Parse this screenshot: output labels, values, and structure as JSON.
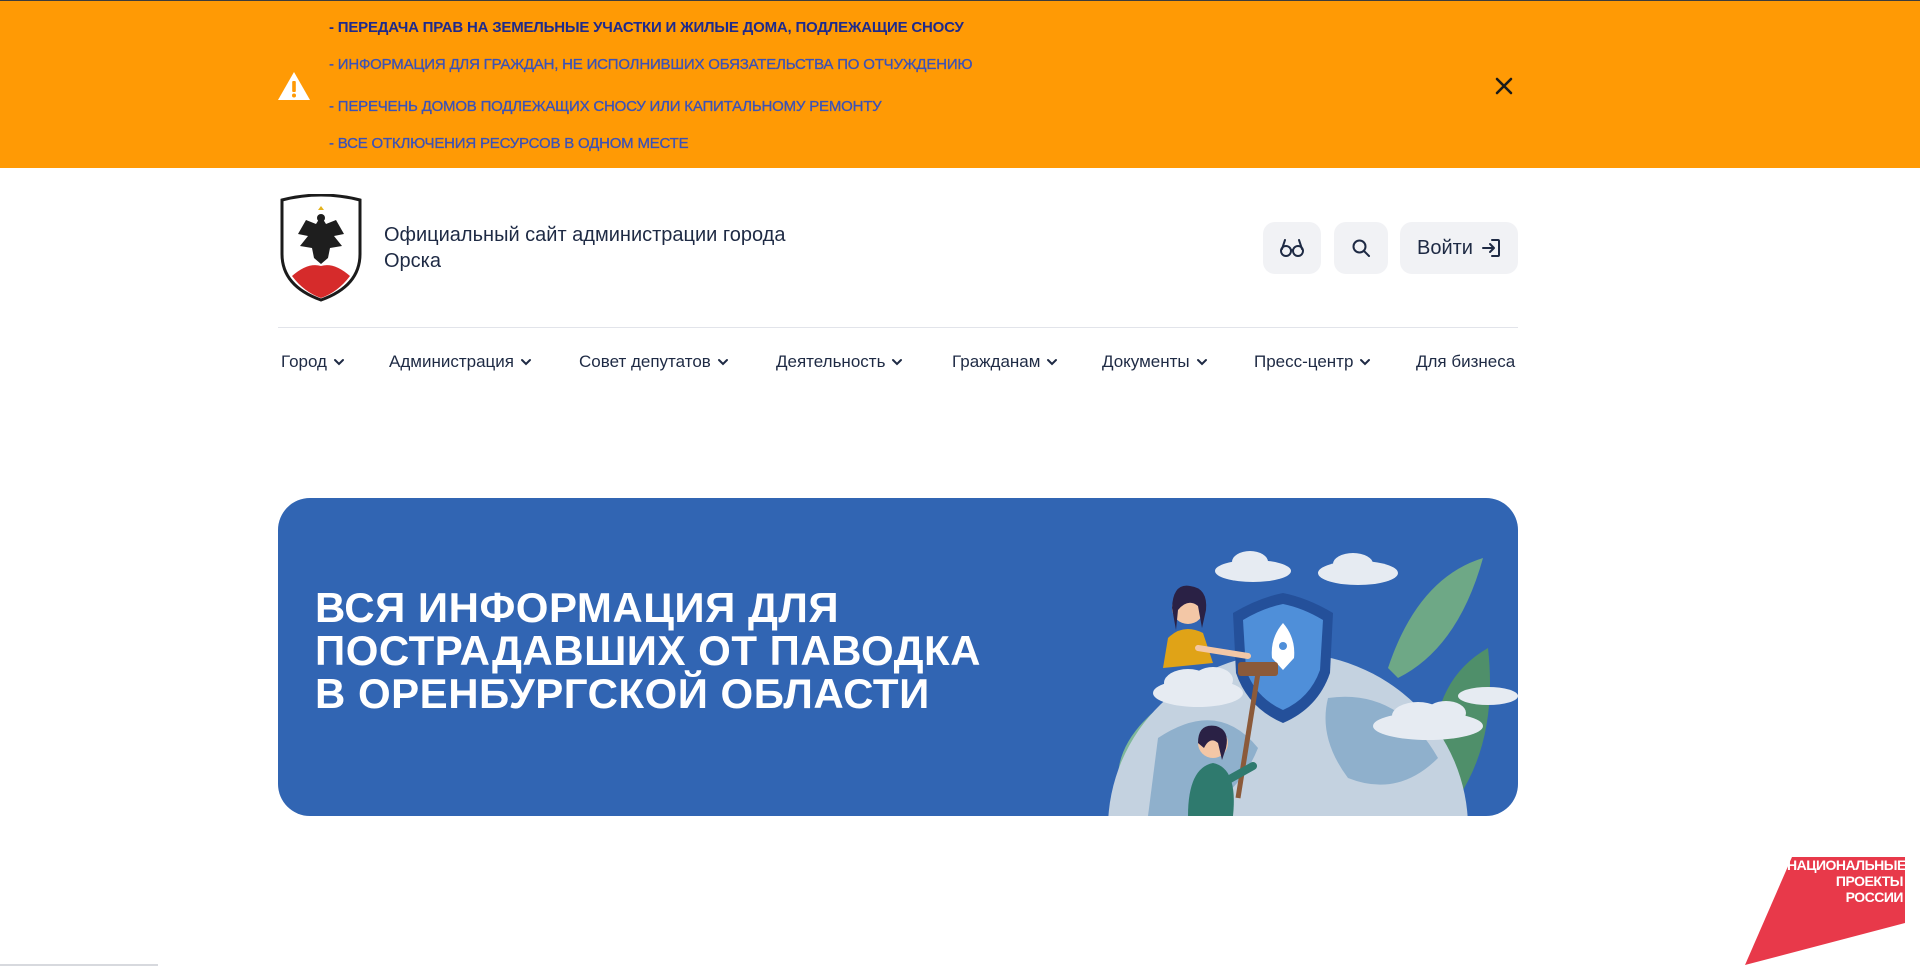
{
  "alert": {
    "links": [
      "- ПЕРЕДАЧА ПРАВ НА ЗЕМЕЛЬНЫЕ УЧАСТКИ И ЖИЛЫЕ ДОМА, ПОДЛЕЖАЩИЕ СНОСУ",
      "- ИНФОРМАЦИЯ ДЛЯ ГРАЖДАН, НЕ ИСПОЛНИВШИХ ОБЯЗАТЕЛЬСТВА ПО ОТЧУЖДЕНИЮ",
      "- ПЕРЕЧЕНЬ ДОМОВ ПОДЛЕЖАЩИХ СНОСУ ИЛИ КАПИТАЛЬНОМУ РЕМОНТУ",
      "- ВСЕ ОТКЛЮЧЕНИЯ РЕСУРСОВ В ОДНОМ МЕСТЕ"
    ],
    "background": "#ff9a05",
    "icon": "warning-icon",
    "close_icon": "close-icon"
  },
  "header": {
    "title_line1": "Официальный сайт администрации города",
    "title_line2": "Орска",
    "login_label": "Войти",
    "eye_icon": "glasses-icon",
    "search_icon": "search-icon",
    "login_icon": "login-icon"
  },
  "nav": {
    "items": [
      "Город",
      "Администрация",
      "Совет депутатов",
      "Деятельность",
      "Гражданам",
      "Документы",
      "Пресс-центр",
      "Для бизнеса"
    ]
  },
  "banner": {
    "line1": "ВСЯ ИНФОРМАЦИЯ ДЛЯ",
    "line2": "ПОСТРАДАВШИХ ОТ ПАВОДКА",
    "line3": "В ОРЕНБУРГСКОЙ ОБЛАСТИ",
    "background": "#3165b3"
  },
  "national_projects": {
    "line1": "НАЦИОНАЛЬНЫЕ",
    "line2": "ПРОЕКТЫ",
    "line3": "РОССИИ",
    "color": "#e8394a"
  }
}
